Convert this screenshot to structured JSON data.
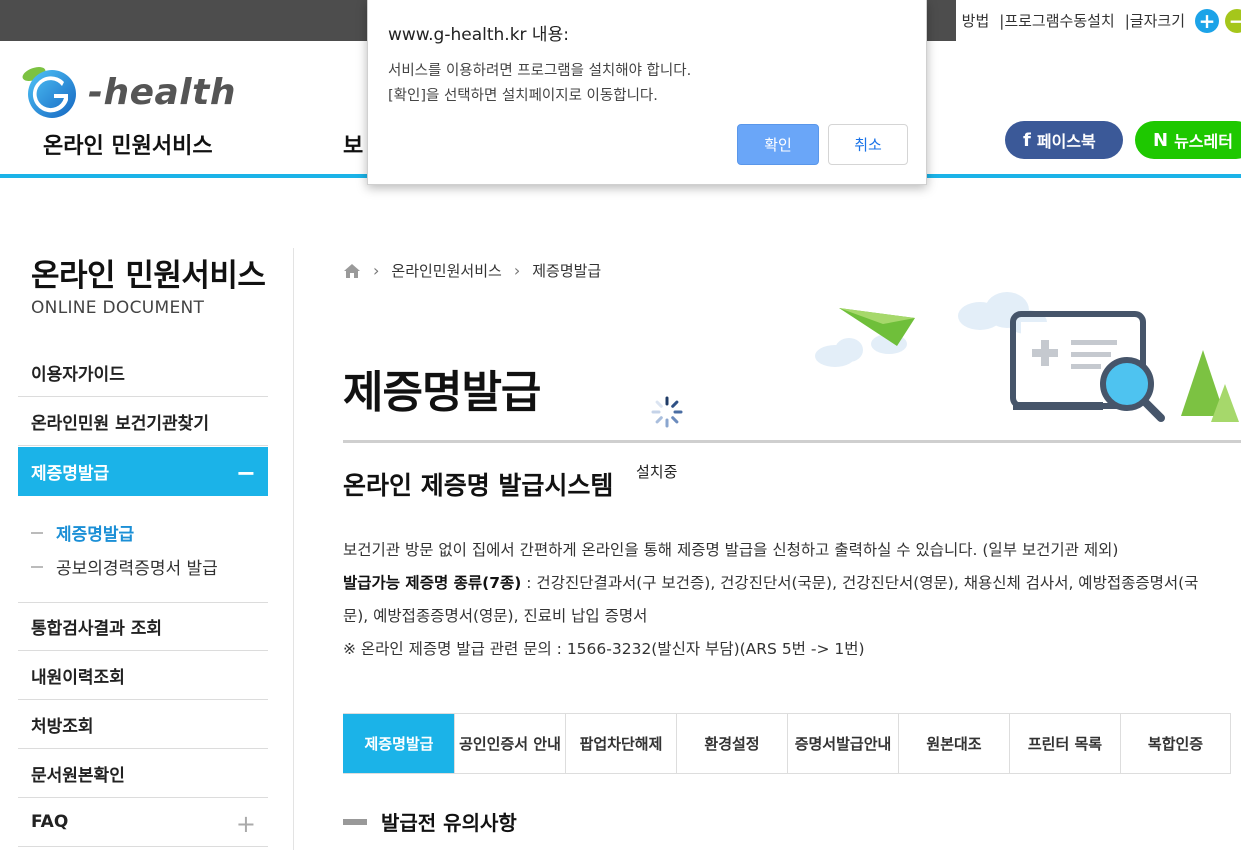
{
  "util_bar": {
    "items": [
      "방법",
      "|프로그램수동설치",
      "|글자크기"
    ],
    "font_plus": "+",
    "font_minus": "−"
  },
  "header": {
    "logo_text": "-health",
    "gnb": [
      "온라인 민원서비스",
      "보"
    ],
    "sns": {
      "facebook": "페이스북",
      "facebook_icon": "f",
      "newsletter": "뉴스레터",
      "newsletter_icon": "N"
    }
  },
  "sidebar": {
    "title": "온라인 민원서비스",
    "subtitle": "ONLINE DOCUMENT",
    "items": [
      {
        "label": "이용자가이드"
      },
      {
        "label": "온라인민원 보건기관찾기"
      },
      {
        "label": "제증명발급",
        "toggle": "−",
        "active": true
      },
      {
        "label": "통합검사결과 조회"
      },
      {
        "label": "내원이력조회"
      },
      {
        "label": "처방조회"
      },
      {
        "label": "문서원본확인"
      },
      {
        "label": "FAQ",
        "toggle": "+"
      }
    ],
    "sub_items": [
      {
        "label": "제증명발급",
        "active": true
      },
      {
        "label": "공보의경력증명서 발급"
      }
    ]
  },
  "breadcrumb": [
    "온라인민원서비스",
    "제증명발급"
  ],
  "main": {
    "title": "제증명발급",
    "installing": "설치중",
    "section_title": "온라인 제증명 발급시스템",
    "desc_line1": "보건기관 방문 없이 집에서 간편하게 온라인을 통해 제증명 발급을 신청하고 출력하실 수 있습니다. (일부 보건기관 제외)",
    "desc_line2_bold": "발급가능 제증명 종류(7종)",
    "desc_line2": " : 건강진단결과서(구 보건증), 건강진단서(국문), 건강진단서(영문), 채용신체 검사서, 예방접종증명서(국",
    "desc_line3": "문), 예방접종증명서(영문), 진료비 납입 증명서",
    "desc_line4": "※ 온라인 제증명 발급 관련 문의 : 1566-3232(발신자 부담)(ARS 5번 -> 1번)",
    "tabs": [
      "제증명발급",
      "공인인증서 안내",
      "팝업차단해제",
      "환경설정",
      "증명서발급안내",
      "원본대조",
      "프린터 목록",
      "복합인증"
    ],
    "active_tab": 0,
    "notice_title": "발급전 유의사항"
  },
  "dialog": {
    "title": "www.g-health.kr 내용:",
    "message_line1": "서비스를 이용하려면 프로그램을 설치해야 합니다.",
    "message_line2": "[확인]을 선택하면 설치페이지로 이동합니다.",
    "ok": "확인",
    "cancel": "취소"
  },
  "colors": {
    "accent": "#1bb3e8",
    "facebook": "#3b5998",
    "newsletter": "#1ec800",
    "dialog_ok": "#6aa6f8"
  }
}
